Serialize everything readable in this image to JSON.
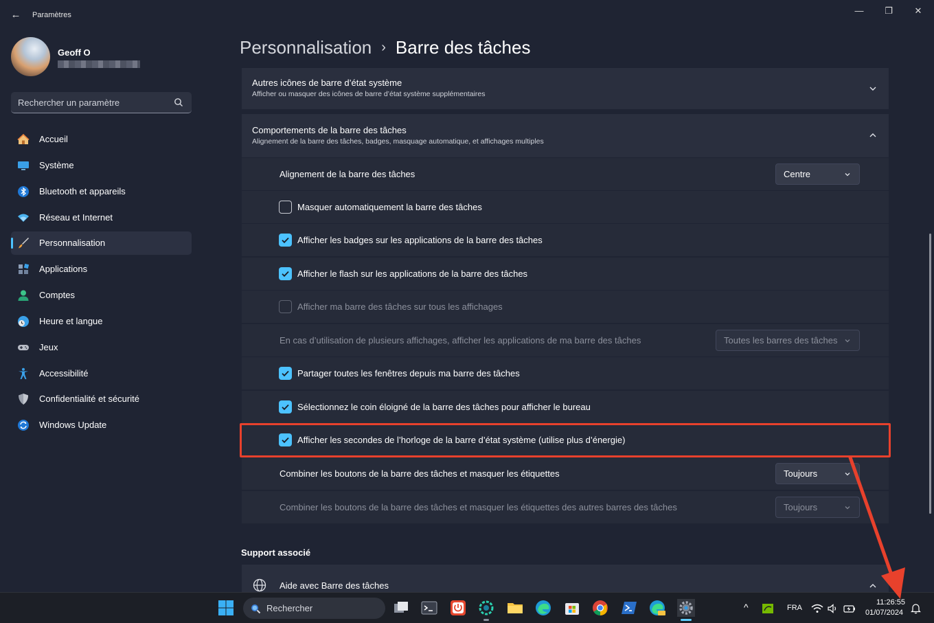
{
  "window": {
    "title": "Paramètres",
    "back_glyph": "←",
    "minimize_glyph": "—",
    "restore_glyph": "❐",
    "close_glyph": "✕"
  },
  "profile": {
    "name": "Geoff O"
  },
  "search": {
    "placeholder": "Rechercher un paramètre"
  },
  "nav": {
    "items": [
      {
        "label": "Accueil",
        "icon": "home-icon"
      },
      {
        "label": "Système",
        "icon": "system-icon"
      },
      {
        "label": "Bluetooth et appareils",
        "icon": "bluetooth-icon"
      },
      {
        "label": "Réseau et Internet",
        "icon": "wifi-icon"
      },
      {
        "label": "Personnalisation",
        "icon": "brush-icon",
        "selected": true
      },
      {
        "label": "Applications",
        "icon": "apps-icon"
      },
      {
        "label": "Comptes",
        "icon": "account-icon"
      },
      {
        "label": "Heure et langue",
        "icon": "clock-globe-icon"
      },
      {
        "label": "Jeux",
        "icon": "gamepad-icon"
      },
      {
        "label": "Accessibilité",
        "icon": "accessibility-icon"
      },
      {
        "label": "Confidentialité et sécurité",
        "icon": "shield-icon"
      },
      {
        "label": "Windows Update",
        "icon": "update-icon"
      }
    ]
  },
  "breadcrumb": {
    "parent": "Personnalisation",
    "separator": "›",
    "current": "Barre des tâches"
  },
  "cards": {
    "tray_icons": {
      "title": "Autres icônes de barre d’état système",
      "desc": "Afficher ou masquer des icônes de barre d’état système supplémentaires"
    },
    "behaviors": {
      "title": "Comportements de la barre des tâches",
      "desc": "Alignement de la barre des tâches, badges, masquage automatique, et affichages multiples"
    }
  },
  "settings": {
    "alignment": {
      "label": "Alignement de la barre des tâches",
      "value": "Centre"
    },
    "autohide": {
      "label": "Masquer automatiquement la barre des tâches",
      "checked": false
    },
    "badges": {
      "label": "Afficher les badges sur les applications de la barre des tâches",
      "checked": true
    },
    "flash": {
      "label": "Afficher le flash sur les applications de la barre des tâches",
      "checked": true
    },
    "all_displays": {
      "label": "Afficher ma barre des tâches sur tous les affichages",
      "checked": false,
      "disabled": true
    },
    "multi_display": {
      "label": "En cas d’utilisation de plusieurs affichages, afficher les applications de ma barre des tâches",
      "value": "Toutes les barres des tâches",
      "disabled": true
    },
    "share_windows": {
      "label": "Partager toutes les fenêtres depuis ma barre des tâches",
      "checked": true
    },
    "far_corner": {
      "label": "Sélectionnez le coin éloigné de la barre des tâches pour afficher le bureau",
      "checked": true
    },
    "seconds": {
      "label": "Afficher les secondes de l’horloge de la barre d’état système (utilise plus d’énergie)",
      "checked": true
    },
    "combine_main": {
      "label": "Combiner les boutons de la barre des tâches et masquer les étiquettes",
      "value": "Toujours"
    },
    "combine_other": {
      "label": "Combiner les boutons de la barre des tâches et masquer les étiquettes des autres barres des tâches",
      "value": "Toujours",
      "disabled": true
    }
  },
  "support": {
    "heading": "Support associé",
    "help_title": "Aide avec Barre des tâches"
  },
  "taskbar": {
    "search_label": "Rechercher",
    "language": "FRA",
    "time": "11:26:55",
    "date": "01/07/2024",
    "tray_chevron": "^"
  },
  "colors": {
    "accent": "#4cc2ff",
    "highlight": "#e8412c",
    "background": "#1f2433",
    "card": "#2a2f3e"
  }
}
